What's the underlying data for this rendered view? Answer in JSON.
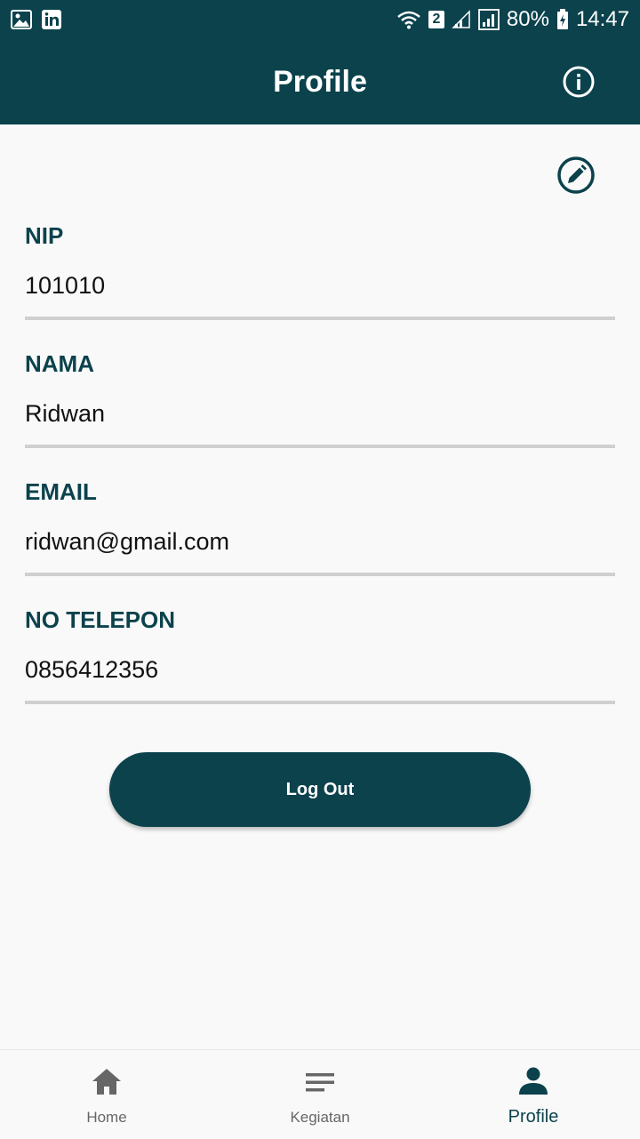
{
  "status_bar": {
    "sim_badge": "2",
    "battery": "80%",
    "time": "14:47"
  },
  "appbar": {
    "title": "Profile",
    "info_icon": "info-icon"
  },
  "edit_icon": "edit-pencil-icon",
  "fields": [
    {
      "label": "NIP",
      "value": "101010"
    },
    {
      "label": "NAMA",
      "value": "Ridwan"
    },
    {
      "label": "EMAIL",
      "value": "ridwan@gmail.com"
    },
    {
      "label": "NO TELEPON",
      "value": "0856412356"
    }
  ],
  "logout_label": "Log Out",
  "bottom_nav": {
    "items": [
      {
        "label": "Home",
        "icon": "home-icon",
        "active": false
      },
      {
        "label": "Kegiatan",
        "icon": "list-icon",
        "active": false
      },
      {
        "label": "Profile",
        "icon": "person-icon",
        "active": true
      }
    ]
  },
  "colors": {
    "primary": "#0b424c",
    "background": "#f9f9f9",
    "divider": "#cfcfcf",
    "inactive_nav": "#666666"
  }
}
